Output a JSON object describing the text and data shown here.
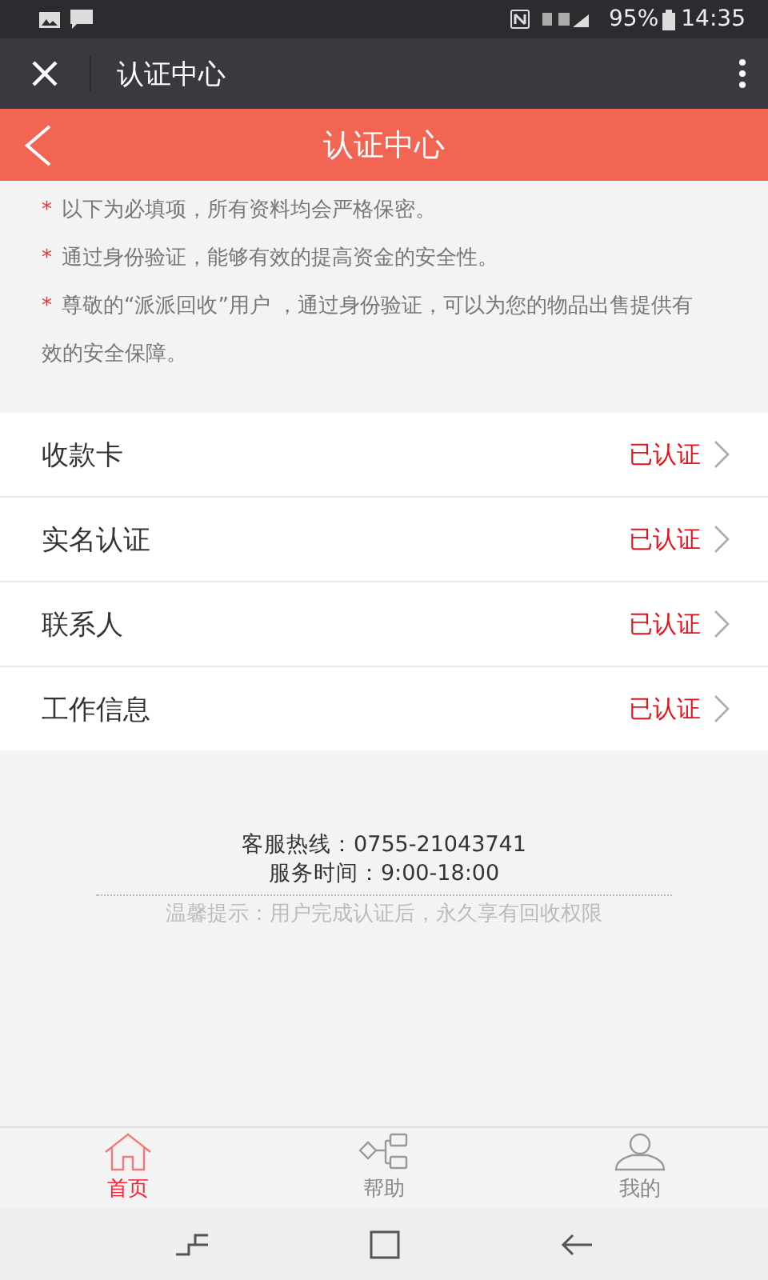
{
  "status_bar": {
    "battery": "95%",
    "time": "14:35"
  },
  "app_bar": {
    "title": "认证中心"
  },
  "header": {
    "title": "认证中心"
  },
  "notes": [
    {
      "mark": "*",
      "text": "以下为必填项，所有资料均会严格保密。"
    },
    {
      "mark": "*",
      "text": "通过身份验证，能够有效的提高资金的安全性。"
    },
    {
      "mark": "*",
      "text": "尊敬的“派派回收”用户 ，通过身份验证，可以为您的物品出售提供有效的安全保障。"
    }
  ],
  "items": [
    {
      "label": "收款卡",
      "status": "已认证"
    },
    {
      "label": "实名认证",
      "status": "已认证"
    },
    {
      "label": "联系人",
      "status": "已认证"
    },
    {
      "label": "工作信息",
      "status": "已认证"
    }
  ],
  "footer": {
    "hotline": "客服热线：0755-21043741",
    "hours": "服务时间：9:00-18:00",
    "tip": "温馨提示：用户完成认证后，永久享有回收权限"
  },
  "tabs": [
    {
      "kind": "home",
      "label": "首页",
      "selected": true
    },
    {
      "kind": "help",
      "label": "帮助",
      "selected": false
    },
    {
      "kind": "me",
      "label": "我的",
      "selected": false
    }
  ]
}
